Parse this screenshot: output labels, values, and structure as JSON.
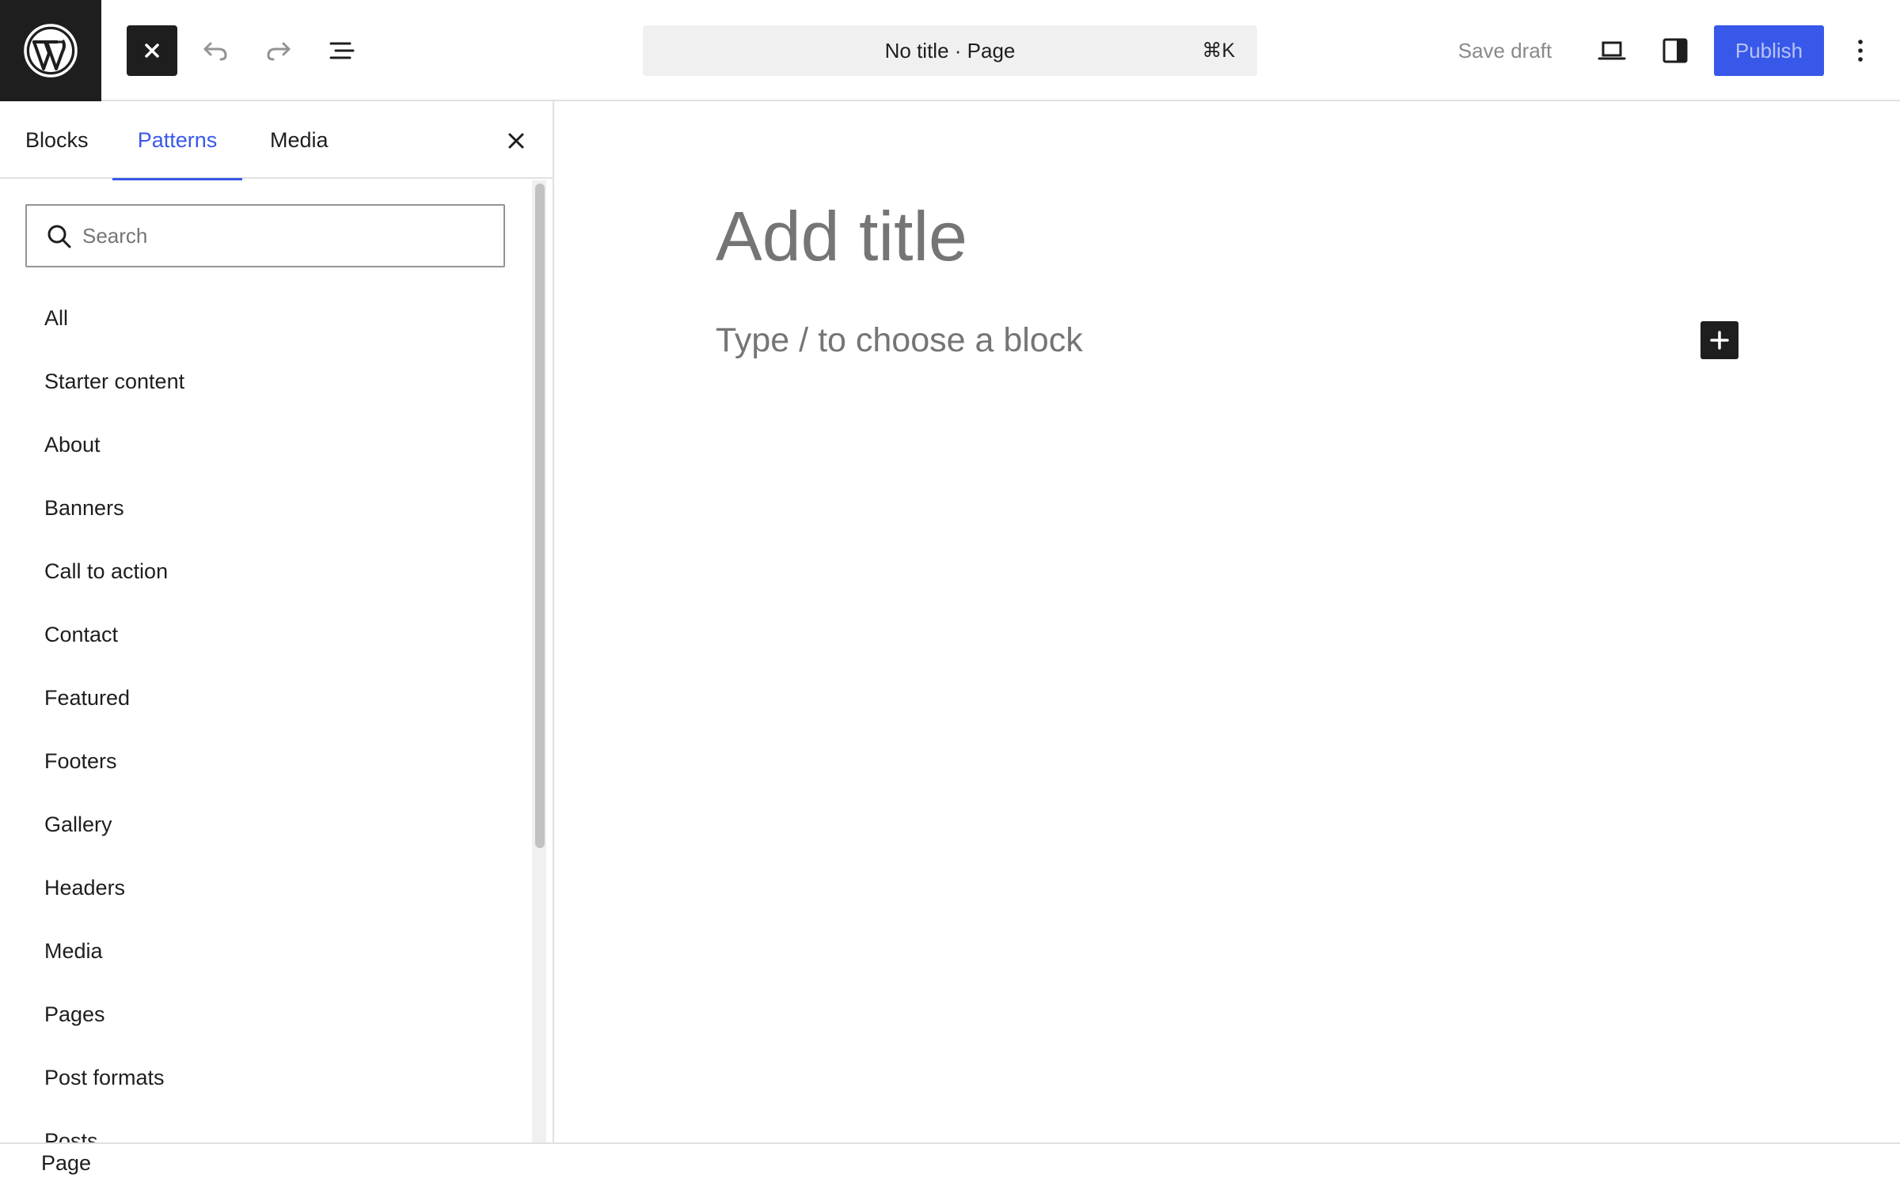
{
  "header": {
    "logo_icon": "wordpress-logo-icon",
    "document_title": "No title · Page",
    "command_shortcut": "⌘K",
    "save_draft_label": "Save draft",
    "publish_label": "Publish",
    "accent_color": "#3858e9"
  },
  "sidebar": {
    "tabs": [
      {
        "label": "Blocks"
      },
      {
        "label": "Patterns"
      },
      {
        "label": "Media"
      }
    ],
    "active_tab": "Patterns",
    "search": {
      "placeholder": "Search",
      "value": ""
    },
    "categories": [
      {
        "label": "All"
      },
      {
        "label": "Starter content"
      },
      {
        "label": "About"
      },
      {
        "label": "Banners"
      },
      {
        "label": "Call to action"
      },
      {
        "label": "Contact"
      },
      {
        "label": "Featured"
      },
      {
        "label": "Footers"
      },
      {
        "label": "Gallery"
      },
      {
        "label": "Headers"
      },
      {
        "label": "Media"
      },
      {
        "label": "Pages"
      },
      {
        "label": "Post formats"
      },
      {
        "label": "Posts"
      }
    ]
  },
  "editor": {
    "title_placeholder": "Add title",
    "block_placeholder": "Type / to choose a block"
  },
  "footer": {
    "breadcrumb": "Page"
  }
}
